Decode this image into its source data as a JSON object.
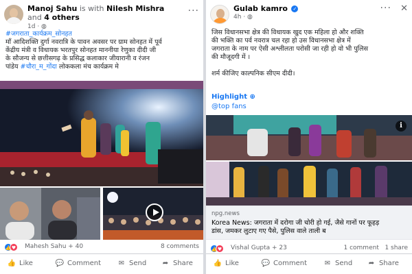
{
  "post_left": {
    "author": "Manoj Sahu",
    "with_label": "is with",
    "tagged": "Nilesh Mishra",
    "and_label": "and",
    "others": "4 others",
    "time": "1d",
    "privacy_icon": "globe-icon",
    "text_line1": "#जगराता_कार्यक्रम_सोनहत",
    "text_line2": "माँ आदिशक्ति दुर्गा नवरात्रि के पावन अवसर पर ग्राम सोनहत में पूर्व",
    "text_line3": "केंद्रीय  मंत्री व विधायक भरतपुर सोनहत माननीया रेणुका दीदी जी",
    "text_line4": "के सौजन्य से छत्तीसगढ़ के प्रसिद्ध कलाकार जीयारानी व रंजन",
    "text_line5_prefix": "पांडेय",
    "text_line5_tag": "#चौरा_म_गोंदा",
    "text_line5_suffix": "लोककला मंच कार्यक्रम मे",
    "reactions_summary": "Mahesh Sahu + 40",
    "comments_count": "8 comments",
    "actions": {
      "like": "Like",
      "comment": "Comment",
      "send": "Send",
      "share": "Share"
    }
  },
  "post_right": {
    "author": "Gulab kamro",
    "verified_icon": "verified-badge-icon",
    "time": "4h",
    "privacy_icon": "globe-icon",
    "text_line1": "जिस विधानसभा क्षेत्र की विधायक खुद एक महिला हो और शक्ति",
    "text_line2": "की भक्ति का पर्व नवरात्र चल रहा हो उस विधानसभा क्षेत्र में",
    "text_line3": "जगराता के नाम पर ऐसी अश्लीलता परोसी जा रही हो वो भी पुलिस",
    "text_line4": "की मौजूदगी में ।",
    "text_line5": "शर्म कीजिए काल्पनिक सीएम दीदी।",
    "highlight_label": "Highlight",
    "top_fans_label": "@top fans",
    "link_domain": "npg.news",
    "link_title_line1": "Korea News: जगराता में दरोगा जी चोरी हो गई, जैसे गानों पर फूहड़",
    "link_title_line2": "डांस, जमकर लुटाए गए पैसे, पुलिस वाले ताली ब",
    "reactions_summary": "Vishal Gupta + 23",
    "comments_count": "1 comment",
    "shares_count": "1 share",
    "actions": {
      "like": "Like",
      "comment": "Comment",
      "send": "Send",
      "share": "Share"
    }
  },
  "colors": {
    "link_blue": "#1877f2",
    "muted": "#65676b",
    "stage_red": "#a8232e"
  }
}
